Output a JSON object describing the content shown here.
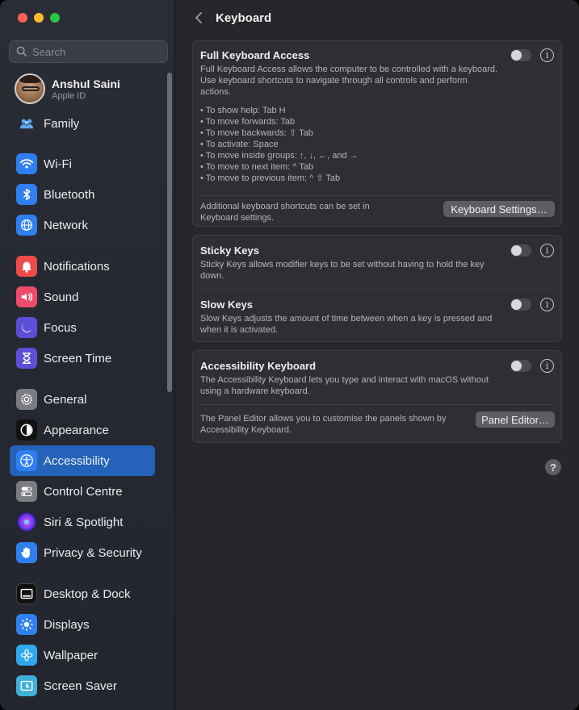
{
  "window": {
    "title": "Keyboard"
  },
  "sidebar": {
    "search": {
      "placeholder": "Search"
    },
    "profile": {
      "name": "Anshul Saini",
      "subtitle": "Apple ID"
    },
    "items": [
      {
        "label": "Family"
      },
      {
        "label": "Wi-Fi"
      },
      {
        "label": "Bluetooth"
      },
      {
        "label": "Network"
      },
      {
        "label": "Notifications"
      },
      {
        "label": "Sound"
      },
      {
        "label": "Focus"
      },
      {
        "label": "Screen Time"
      },
      {
        "label": "General"
      },
      {
        "label": "Appearance"
      },
      {
        "label": "Accessibility"
      },
      {
        "label": "Control Centre"
      },
      {
        "label": "Siri & Spotlight"
      },
      {
        "label": "Privacy & Security"
      },
      {
        "label": "Desktop & Dock"
      },
      {
        "label": "Displays"
      },
      {
        "label": "Wallpaper"
      },
      {
        "label": "Screen Saver"
      }
    ],
    "active_item": "Accessibility"
  },
  "main": {
    "title": "Keyboard",
    "full_keyboard_access": {
      "title": "Full Keyboard Access",
      "description": "Full Keyboard Access allows the computer to be controlled with a keyboard. Use keyboard shortcuts to navigate through all controls and perform actions.",
      "shortcuts": [
        "• To show help: Tab H",
        "• To move forwards: Tab",
        "• To move backwards: ⇧ Tab",
        "• To activate: Space",
        "• To move inside groups: ↑, ↓, ←, and →",
        "• To move to next item: ^ Tab",
        "• To move to previous item: ^ ⇧ Tab"
      ],
      "enabled": false,
      "footer_text": "Additional keyboard shortcuts can be set in Keyboard settings.",
      "button_label": "Keyboard Settings…"
    },
    "sticky_keys": {
      "title": "Sticky Keys",
      "description": "Sticky Keys allows modifier keys to be set without having to hold the key down.",
      "enabled": false
    },
    "slow_keys": {
      "title": "Slow Keys",
      "description": "Slow Keys adjusts the amount of time between when a key is pressed and when it is activated.",
      "enabled": false
    },
    "accessibility_keyboard": {
      "title": "Accessibility Keyboard",
      "description": "The Accessibility Keyboard lets you type and interact with macOS without using a hardware keyboard.",
      "enabled": false,
      "footer_text": "The Panel Editor allows you to customise the panels shown by Accessibility Keyboard.",
      "button_label": "Panel Editor…"
    },
    "help_label": "?",
    "info_label": "i"
  },
  "colors": {
    "accent": "#2463b9",
    "sidebar_bg": "#262932",
    "main_bg": "#26272b",
    "card_bg": "#2e2f33"
  }
}
